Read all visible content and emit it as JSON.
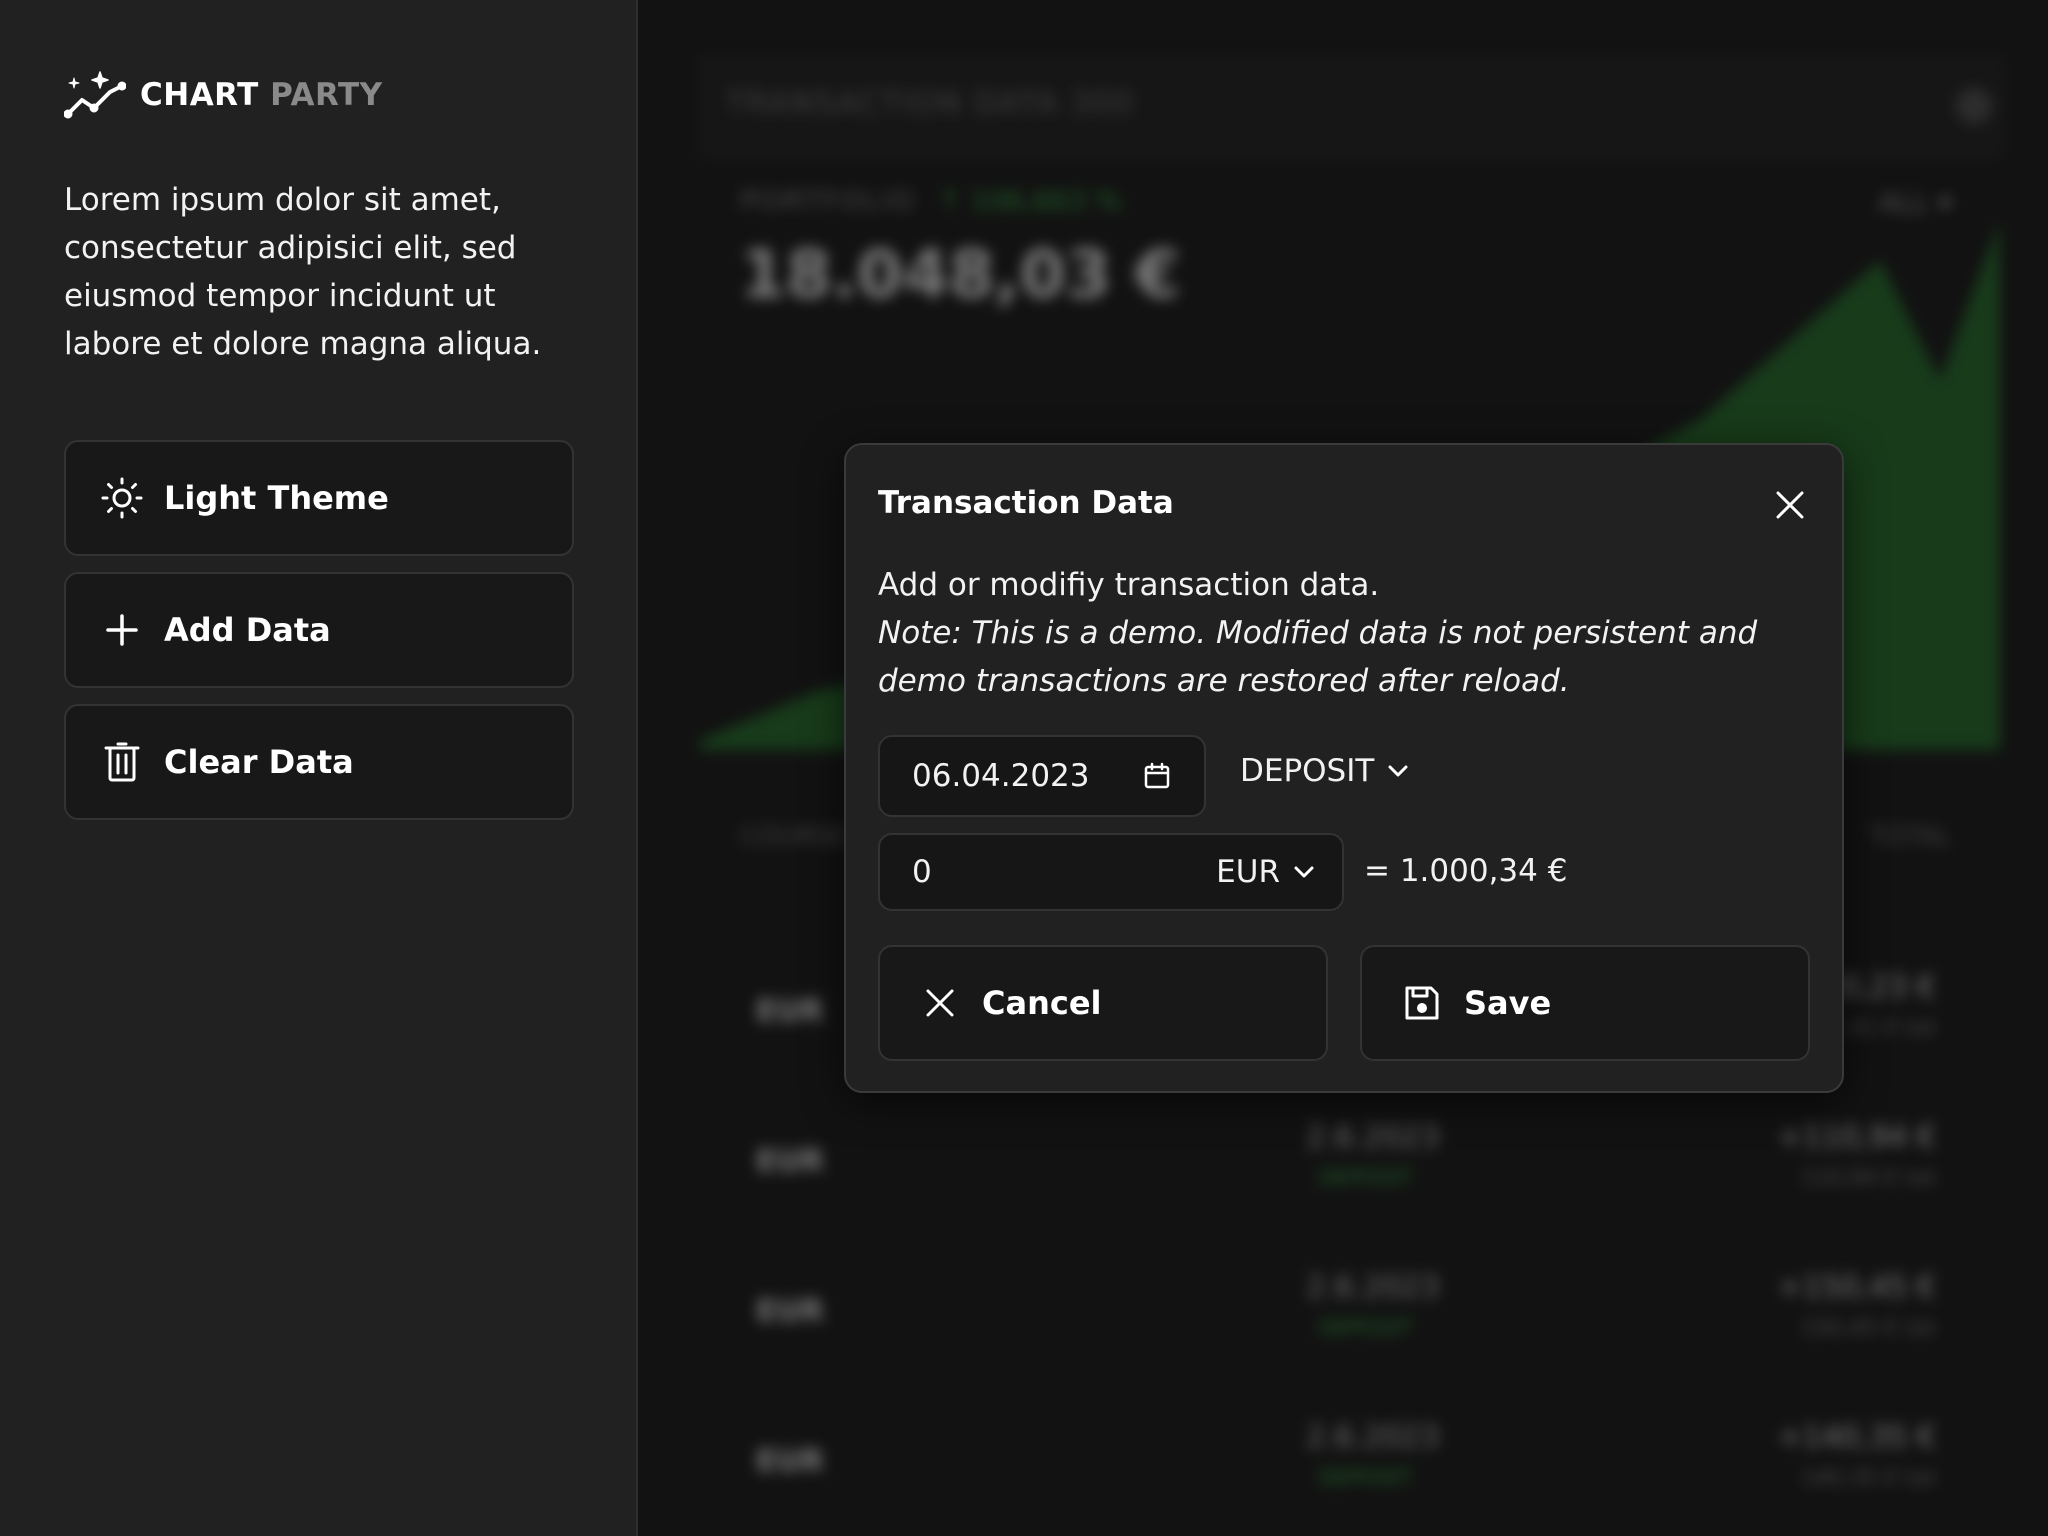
{
  "brand": {
    "name": "CHART",
    "accent": "PARTY",
    "icon": "sparkle-chart-icon"
  },
  "sidebar": {
    "intro": "Lorem ipsum dolor sit amet, consectetur adipisici elit, sed eiusmod tempor incidunt ut labore et dolore magna aliqua.",
    "buttons": {
      "light_theme": {
        "label": "Light Theme",
        "icon": "sun-icon"
      },
      "add_data": {
        "label": "Add Data",
        "icon": "plus-icon"
      },
      "clear_data": {
        "label": "Clear Data",
        "icon": "trash-icon"
      }
    }
  },
  "background": {
    "title": "TRANSACTION DATA 300",
    "portfolio_label": "PORTFOLIO",
    "portfolio_change": "↑ 106,663 %",
    "portfolio_value": "18.048,03 €",
    "range": "ALL ▾",
    "col_left": "COURSE",
    "col_right": "TOTAL",
    "rows": [
      {
        "cur": "EUR",
        "date": "",
        "type": "",
        "amt": "+180,23 €",
        "sub": "162,41 € tot"
      },
      {
        "cur": "EUR",
        "date": "2.6.2023",
        "type": "DEPOSIT",
        "amt": "+110,94 €",
        "sub": "110,94 € tot"
      },
      {
        "cur": "EUR",
        "date": "2.6.2023",
        "type": "DEPOSIT",
        "amt": "+150,45 €",
        "sub": "150,45 € tot"
      },
      {
        "cur": "EUR",
        "date": "2.6.2023",
        "type": "DEPOSIT",
        "amt": "+140,35 €",
        "sub": "140,35 € tot"
      }
    ]
  },
  "dialog": {
    "title": "Transaction Data",
    "description": "Add or modifiy transaction data.",
    "note": "Note: This is a demo. Modified data is not persistent and demo transactions are restored after reload.",
    "date_value": "06.04.2023",
    "type_value": "DEPOSIT",
    "amount_value": "0",
    "currency_value": "EUR",
    "equivalent": "= 1.000,34 €",
    "cancel_label": "Cancel",
    "save_label": "Save"
  },
  "colors": {
    "sidebar_bg": "#212121",
    "app_bg": "#121212",
    "button_bg": "#181818",
    "border": "#333333",
    "accent_green": "#2e9e3a",
    "brand_muted": "#8a8a8a"
  }
}
